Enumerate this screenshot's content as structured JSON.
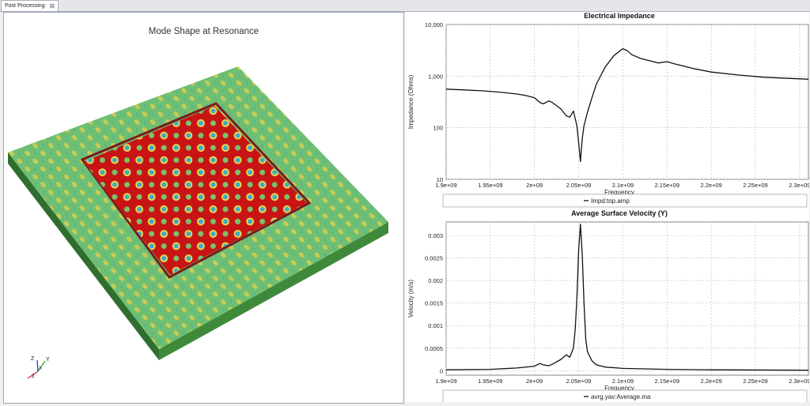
{
  "tab": {
    "label": "Post Processing:"
  },
  "viewport": {
    "title": "Mode Shape at Resonance",
    "axis_labels": [
      "Y",
      "Z",
      "X",
      "Z"
    ],
    "colors": {
      "outer": "#6fbf73",
      "center": "#c81414",
      "side": "#3f8a3a"
    }
  },
  "chart_data": [
    {
      "type": "line",
      "title": "Electrical Impedance",
      "xlabel": "Frequency",
      "ylabel": "Impedance (Ohms)",
      "yscale": "log",
      "xlim": [
        1900000000.0,
        2310000000.0
      ],
      "ylim": [
        10,
        10000
      ],
      "xticks": [
        "1.9e+09",
        "1.95e+09",
        "2e+09",
        "2.05e+09",
        "2.1e+09",
        "2.15e+09",
        "2.2e+09",
        "2.25e+09",
        "2.3e+09"
      ],
      "yticks": [
        "10,000",
        "1,000",
        "100",
        "10"
      ],
      "grid": true,
      "legend": "Impd:top.amp",
      "series": [
        {
          "name": "Impd:top.amp",
          "x": [
            1900000000.0,
            1920000000.0,
            1940000000.0,
            1960000000.0,
            1980000000.0,
            1990000000.0,
            2000000000.0,
            2006000000.0,
            2010000000.0,
            2016000000.0,
            2020000000.0,
            2030000000.0,
            2036000000.0,
            2040000000.0,
            2044000000.0,
            2048000000.0,
            2050000000.0,
            2052000000.0,
            2054000000.0,
            2056000000.0,
            2060000000.0,
            2065000000.0,
            2070000000.0,
            2080000000.0,
            2090000000.0,
            2100000000.0,
            2105000000.0,
            2110000000.0,
            2120000000.0,
            2130000000.0,
            2140000000.0,
            2150000000.0,
            2160000000.0,
            2180000000.0,
            2200000000.0,
            2230000000.0,
            2260000000.0,
            2290000000.0,
            2310000000.0
          ],
          "values": [
            560,
            540,
            520,
            490,
            450,
            420,
            380,
            310,
            290,
            330,
            310,
            230,
            170,
            160,
            210,
            110,
            50,
            22,
            60,
            110,
            200,
            380,
            700,
            1500,
            2500,
            3400,
            3100,
            2600,
            2200,
            2000,
            1800,
            1900,
            1700,
            1400,
            1200,
            1050,
            950,
            900,
            870
          ]
        }
      ]
    },
    {
      "type": "line",
      "title": "Average Surface Velocity (Y)",
      "xlabel": "Frequency",
      "ylabel": "Velocity (m/s)",
      "xlim": [
        1900000000.0,
        2310000000.0
      ],
      "ylim": [
        -0.0001,
        0.0033
      ],
      "xticks": [
        "1.9e+09",
        "1.95e+09",
        "2e+09",
        "2.05e+09",
        "2.1e+09",
        "2.15e+09",
        "2.2e+09",
        "2.25e+09",
        "2.3e+09"
      ],
      "yticks": [
        "0.003",
        "0.0025",
        "0.002",
        "0.0015",
        "0.001",
        "0.0005",
        "0"
      ],
      "grid": true,
      "legend": "avrg.yav:Average.ma",
      "series": [
        {
          "name": "avrg.yav:Average.ma",
          "x": [
            1900000000.0,
            1950000000.0,
            1980000000.0,
            2000000000.0,
            2006000000.0,
            2010000000.0,
            2016000000.0,
            2020000000.0,
            2030000000.0,
            2036000000.0,
            2040000000.0,
            2044000000.0,
            2046000000.0,
            2048000000.0,
            2050000000.0,
            2052000000.0,
            2054000000.0,
            2056000000.0,
            2058000000.0,
            2060000000.0,
            2065000000.0,
            2070000000.0,
            2080000000.0,
            2100000000.0,
            2150000000.0,
            2200000000.0,
            2310000000.0
          ],
          "values": [
            2e-05,
            3e-05,
            6e-05,
            0.0001,
            0.00016,
            0.00013,
            0.00011,
            0.00014,
            0.00025,
            0.00035,
            0.0003,
            0.0005,
            0.0009,
            0.0016,
            0.0027,
            0.00325,
            0.0026,
            0.0015,
            0.0007,
            0.00042,
            0.00022,
            0.00013,
            8e-05,
            5e-05,
            3e-05,
            2e-05,
            1e-05
          ]
        }
      ]
    }
  ]
}
